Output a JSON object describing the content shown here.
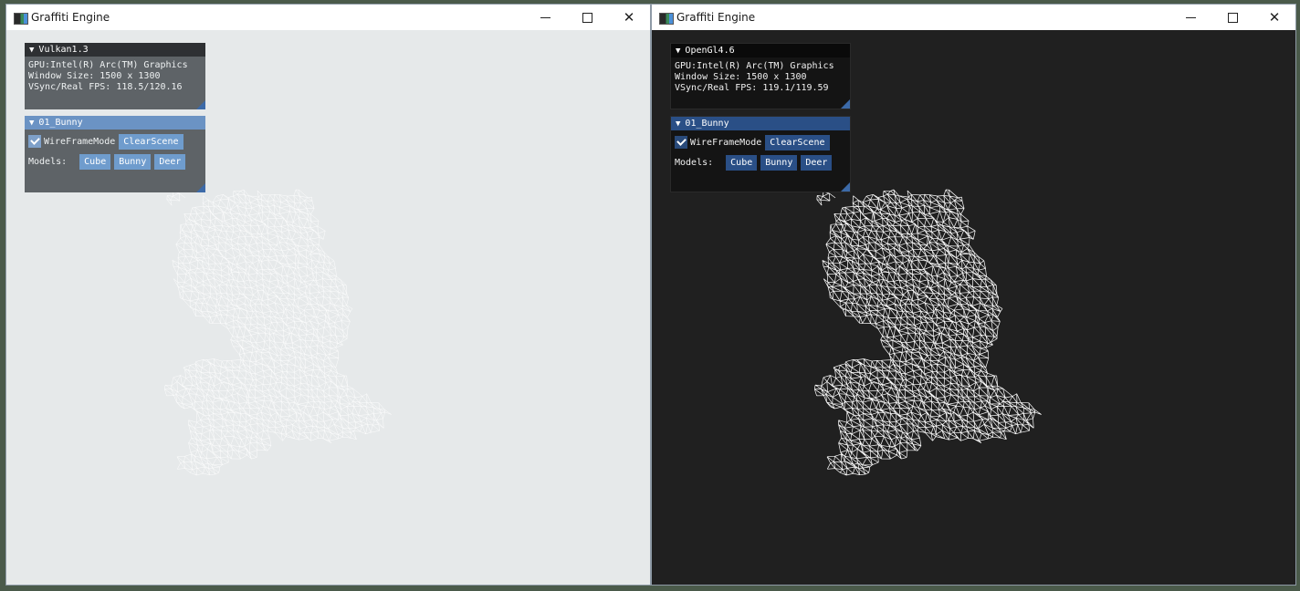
{
  "windows": [
    {
      "title": "Graffiti Engine",
      "api": "Vulkan1.3",
      "gpu": "GPU:Intel(R) Arc(TM) Graphics",
      "window_size": "Window Size: 1500 x 1300",
      "fps": "VSync/Real FPS: 118.5/120.16",
      "scene_panel": "01_Bunny",
      "wireframe_label": "WireFrameMode",
      "wireframe_checked": true,
      "clear_scene": "ClearScene",
      "models_label": "Models:",
      "models": [
        "Cube",
        "Bunny",
        "Deer"
      ],
      "viewport_bg": "#e6e9ea",
      "wire_color": "#ffffff"
    },
    {
      "title": "Graffiti Engine",
      "api": "OpenGl4.6",
      "gpu": "GPU:Intel(R) Arc(TM) Graphics",
      "window_size": "Window Size: 1500 x 1300",
      "fps": "VSync/Real FPS: 119.1/119.59",
      "scene_panel": "01_Bunny",
      "wireframe_label": "WireFrameMode",
      "wireframe_checked": true,
      "clear_scene": "ClearScene",
      "models_label": "Models:",
      "models": [
        "Cube",
        "Bunny",
        "Deer"
      ],
      "viewport_bg": "#202020",
      "wire_color": "#ffffff"
    }
  ],
  "window_controls": {
    "minimize_icon": "minimize-icon",
    "maximize_icon": "maximize-icon",
    "close_icon": "close-icon",
    "close_glyph": "✕"
  }
}
